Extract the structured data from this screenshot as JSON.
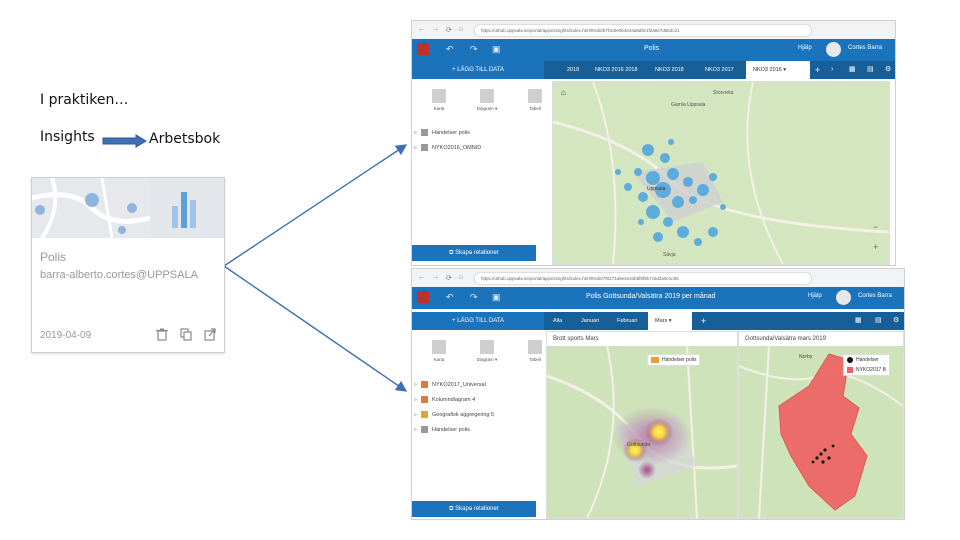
{
  "slide": {
    "heading": "I praktiken…",
    "flow_from": "Insights",
    "flow_to": "Arbetsbok"
  },
  "card": {
    "title": "Polis",
    "owner": "barra-alberto.cortes@UPPSALA",
    "date": "2019-04-09",
    "actions": [
      "trash-icon",
      "copy-icon",
      "share-icon"
    ]
  },
  "window1": {
    "url": "https://uthub.uppsala.se/portal/apps/insights/index.html#/edit/b7f3c9e0b4e44a8d9c1f2a6e7d5b3c21",
    "app_title": "Polis",
    "help": "Hjälp",
    "user": "Cortes Barra",
    "add_data": "LÄGG TILL DATA",
    "tabs": [
      "2018",
      "NKO3 2016 2018",
      "NKO3 2018",
      "NKO3 2017",
      "NKO3 2016"
    ],
    "active_tab": "NKO3 2016",
    "tools": [
      "Karta",
      "Diagram",
      "Tabell"
    ],
    "datasets": [
      "Händelser polis",
      "NYKO2016_OMNID"
    ],
    "create_relations": "Skapa relationer",
    "map_labels": [
      "Storvreta",
      "Uppsala",
      "Sävja",
      "Gamla Uppsala"
    ]
  },
  "window2": {
    "url": "https://uthub.uppsala.se/portal/apps/insights/index.html#/edit/7f0271a9e4e34b5f8f9b7c6d2a0e1c55",
    "app_title": "Polis Gottsunda/Valsätra 2019 per månad",
    "help": "Hjälp",
    "user": "Cortes Barra",
    "add_data": "LÄGG TILL DATA",
    "tabs": [
      "Alla",
      "Januari",
      "Februari",
      "Mars"
    ],
    "active_tab": "Mars",
    "tools": [
      "Karta",
      "Diagram",
      "Tabell"
    ],
    "datasets": [
      "NYKO2017_Universal",
      "Kolumndiagram 4",
      "Geografisk aggregering 5",
      "Händelser polis"
    ],
    "create_relations": "Skapa relationer",
    "map1_title": "Brott sports Mars",
    "map1_legend": "Händelser polis",
    "map1_label": "Gottsunda",
    "map2_title": "Gottsunda/Valsätra mars 2019",
    "map2_legend_1": "Händelser",
    "map2_legend_2": "NYKO2017 B",
    "map2_label": "Norby"
  },
  "colors": {
    "brand_blue": "#1b74bb",
    "dark_blue": "#175f99",
    "point_blue": "#4aa3df",
    "heat_yellow": "#f6d53b",
    "heat_purple": "#8e3f8c",
    "area_red": "#ef6060",
    "map_green": "#cfe3bb"
  }
}
